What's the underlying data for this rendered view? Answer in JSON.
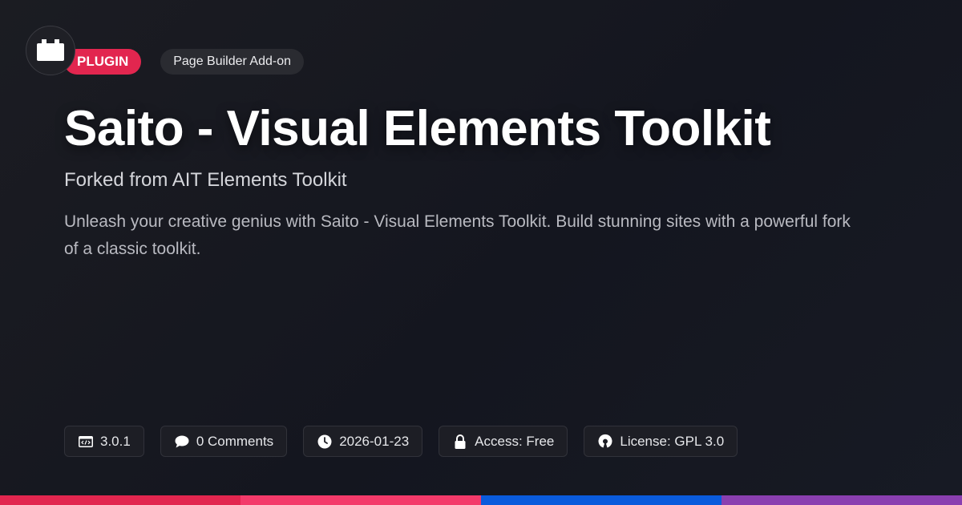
{
  "tags": {
    "type": "PLUGIN",
    "category": "Page Builder Add-on"
  },
  "title": "Saito - Visual Elements Toolkit",
  "subtitle": "Forked from AIT Elements Toolkit",
  "description": "Unleash your creative genius with Saito - Visual Elements Toolkit. Build stunning sites with a powerful fork of a classic toolkit.",
  "meta": [
    {
      "icon": "code-window-icon",
      "label": "3.0.1"
    },
    {
      "icon": "comment-icon",
      "label": "0 Comments"
    },
    {
      "icon": "clock-icon",
      "label": "2026-01-23"
    },
    {
      "icon": "lock-icon",
      "label": "Access: Free"
    },
    {
      "icon": "open-source-icon",
      "label": "License: GPL 3.0"
    }
  ],
  "colors": {
    "accent": "#e2264f",
    "bottom_bar": [
      "#e2264f",
      "#f33a6a",
      "#0a5bdc",
      "#8a3fb0"
    ]
  }
}
